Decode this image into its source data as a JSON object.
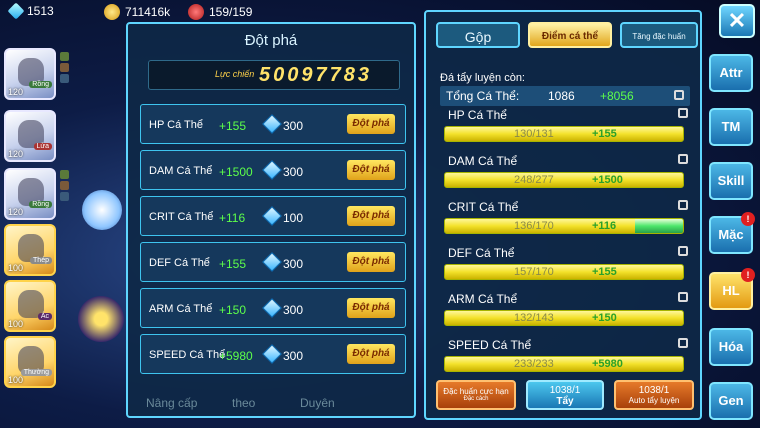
{
  "topbar": {
    "gems": "1513",
    "gold": "711416k",
    "stamina": "159/159"
  },
  "left_heroes": [
    {
      "level": "120",
      "tag": "Rồng"
    },
    {
      "level": "120",
      "tag": "Lửa"
    },
    {
      "level": "120",
      "tag": "Rồng"
    },
    {
      "level": "100",
      "tag": "Thép"
    },
    {
      "level": "100",
      "tag": "Ác"
    },
    {
      "level": "100",
      "tag": "Thường"
    }
  ],
  "dot_pha_panel": {
    "title": "Đột phá",
    "power_label": "Lực chiến",
    "power_value": "50097783",
    "rows": [
      {
        "name": "HP Cá Thể",
        "plus": "+155",
        "cost": "300",
        "button": "Đột phá"
      },
      {
        "name": "DAM Cá Thể",
        "plus": "+1500",
        "cost": "300",
        "button": "Đột phá"
      },
      {
        "name": "CRIT Cá Thể",
        "plus": "+116",
        "cost": "100",
        "button": "Đột phá"
      },
      {
        "name": "DEF Cá Thể",
        "plus": "+155",
        "cost": "300",
        "button": "Đột phá"
      },
      {
        "name": "ARM Cá Thể",
        "plus": "+150",
        "cost": "300",
        "button": "Đột phá"
      },
      {
        "name": "SPEED Cá Thể",
        "plus": "+5980",
        "cost": "300",
        "button": "Đột phá"
      }
    ],
    "bottom_tabs": [
      "Nâng cấp",
      "theo",
      "Duyên"
    ]
  },
  "right_panel": {
    "tabs": {
      "merge": "Gộp",
      "points": "Điểm cá thể",
      "special": "Tăng đặc huấn"
    },
    "remaining_label": "Đá tẩy luyện còn:",
    "total_label": "Tổng Cá Thể:",
    "total_value": "1086",
    "total_plus": "+8056",
    "stats": [
      {
        "name": "HP Cá Thể",
        "current": "130/131",
        "plus": "+155",
        "fill": 1.0
      },
      {
        "name": "DAM Cá Thể",
        "current": "248/277",
        "plus": "+1500",
        "fill": 1.0
      },
      {
        "name": "CRIT Cá Thể",
        "current": "136/170",
        "plus": "+116",
        "fill": 0.8
      },
      {
        "name": "DEF Cá Thể",
        "current": "157/170",
        "plus": "+155",
        "fill": 1.0
      },
      {
        "name": "ARM Cá Thể",
        "current": "132/143",
        "plus": "+150",
        "fill": 1.0
      },
      {
        "name": "SPEED Cá Thể",
        "current": "233/233",
        "plus": "+5980",
        "fill": 1.0
      }
    ],
    "buttons": {
      "special_label": "Đặc huấn cực hạn",
      "special_sub": "Đặc cách",
      "wash_count": "1038/1",
      "wash_label": "Tẩy",
      "auto_count": "1038/1",
      "auto_label": "Auto tẩy luyện"
    }
  },
  "side_menu": [
    {
      "label": "Attr",
      "badge": ""
    },
    {
      "label": "TM",
      "badge": ""
    },
    {
      "label": "Skill",
      "badge": ""
    },
    {
      "label": "Mặc",
      "badge": "!"
    },
    {
      "label": "HL",
      "badge": "!"
    },
    {
      "label": "Hóa",
      "badge": ""
    },
    {
      "label": "Gen",
      "badge": ""
    }
  ]
}
